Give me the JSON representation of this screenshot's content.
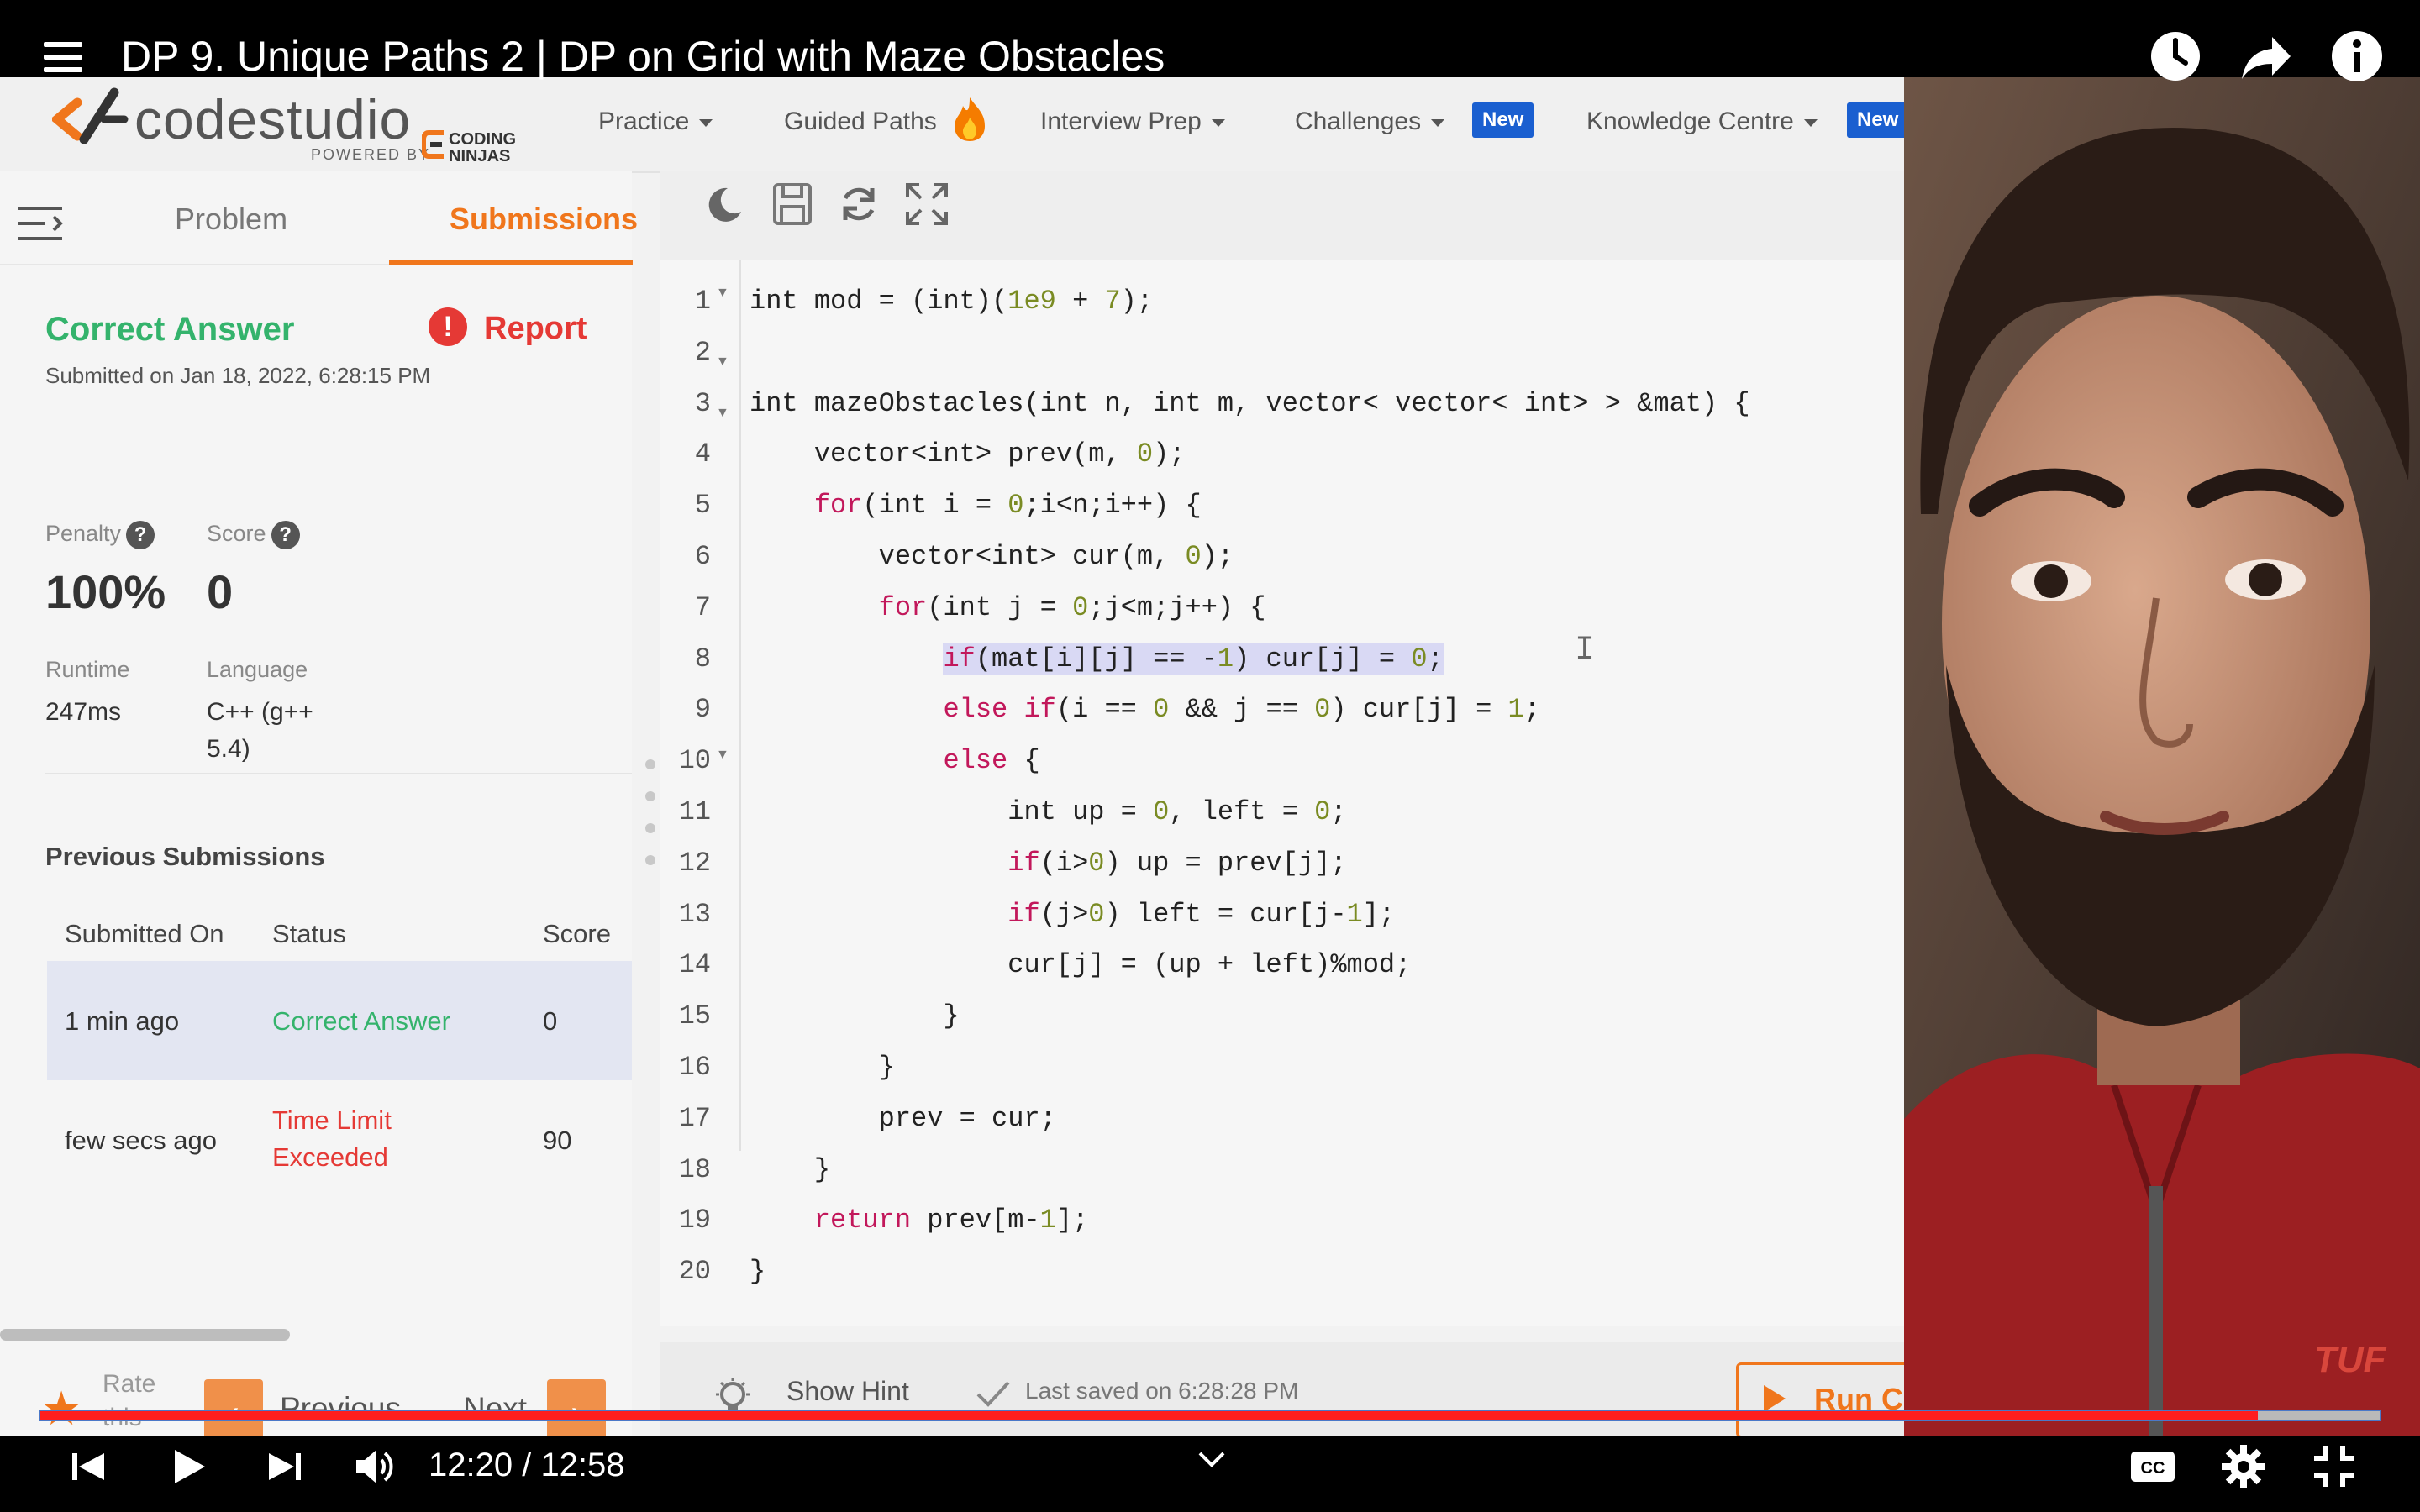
{
  "video": {
    "title": "DP 9. Unique Paths 2 | DP on Grid with Maze Obstacles",
    "time": "12:20 / 12:58",
    "progress": 0.948
  },
  "site": {
    "logo": "codestudio",
    "powered_by": "POWERED BY",
    "brand_small": "CODING NINJAS",
    "nav": [
      {
        "label": "Practice"
      },
      {
        "label": "Guided Paths"
      },
      {
        "label": "Interview Prep"
      },
      {
        "label": "Challenges",
        "badge": "New"
      },
      {
        "label": "Knowledge Centre",
        "badge": "New"
      }
    ]
  },
  "left": {
    "tabs": {
      "problem": "Problem",
      "submissions": "Submissions"
    },
    "status": "Correct Answer",
    "report": "Report",
    "submitted": "Submitted on Jan 18, 2022, 6:28:15 PM",
    "penalty_label": "Penalty",
    "penalty_value": "100%",
    "score_label": "Score",
    "score_value": "0",
    "runtime_label": "Runtime",
    "runtime_value": "247ms",
    "language_label": "Language",
    "language_value_1": "C++ (g++",
    "language_value_2": "5.4)",
    "prev_title": "Previous Submissions",
    "table": {
      "headers": [
        "Submitted On",
        "Status",
        "Score"
      ],
      "rows": [
        {
          "submitted": "1 min ago",
          "status": "Correct Answer",
          "score": "0"
        },
        {
          "submitted": "few secs ago",
          "status_1": "Time Limit",
          "status_2": "Exceeded",
          "score": "90"
        }
      ]
    },
    "rate_1": "Rate",
    "rate_2": "this",
    "previous": "Previous",
    "next": "Next"
  },
  "editor": {
    "hint": "Show Hint",
    "saved": "Last saved on 6:28:28 PM",
    "run": "Run C"
  },
  "code_lines": [
    "int mod = (int)(1e9 + 7);",
    "",
    "int mazeObstacles(int n, int m, vector< vector< int> > &mat) {",
    "    vector<int> prev(m, 0);",
    "    for(int i = 0;i<n;i++) {",
    "        vector<int> cur(m, 0);",
    "        for(int j = 0;j<m;j++) {",
    "            if(mat[i][j] == -1) cur[j] = 0;",
    "            else if(i == 0 && j == 0) cur[j] = 1;",
    "            else {",
    "                int up = 0, left = 0;",
    "                if(i>0) up = prev[j];",
    "                if(j>0) left = cur[j-1];",
    "                cur[j] = (up + left)%mod;",
    "            }",
    "        }",
    "        prev = cur;",
    "    }",
    "    return prev[m-1];",
    "}"
  ],
  "line_numbers": [
    "1",
    "2",
    "3",
    "4",
    "5",
    "6",
    "7",
    "8",
    "9",
    "10",
    "11",
    "12",
    "13",
    "14",
    "15",
    "16",
    "17",
    "18",
    "19",
    "20"
  ],
  "watermark": "TUF",
  "colors": {
    "accent": "#f0761c",
    "success": "#34b36c",
    "error": "#e53935",
    "progress": "#ff1e1e"
  }
}
